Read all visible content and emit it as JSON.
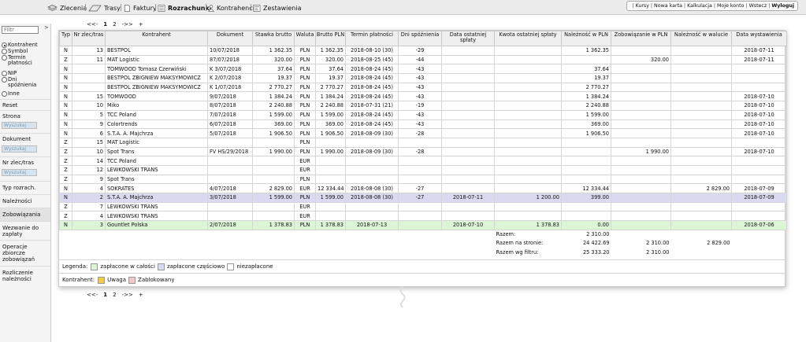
{
  "topmenu": {
    "items": [
      {
        "label": "Zlecenia"
      },
      {
        "label": "Trasy"
      },
      {
        "label": "Faktury"
      },
      {
        "label": "Rozrachunki"
      },
      {
        "label": "Kontrahenci"
      },
      {
        "label": "Zestawienia"
      }
    ],
    "active": "Rozrachunki"
  },
  "toplinks": [
    "Kursy",
    "Nowa karta",
    "Kalkulacja",
    "Moje konto",
    "Wstecz",
    "Wyloguj"
  ],
  "sidebar": {
    "filter_placeholder": "Filtr",
    "collapse": ">",
    "radio_options": [
      "Kontrahent",
      "Symbol",
      "Termin płatności",
      "NIP",
      "Dni spóźnienia",
      "Inne"
    ],
    "radio_selected": "Kontrahent",
    "reset": "Reset",
    "strona": "Strona",
    "search_placeholder": "Wyszukaj",
    "dokument": "Dokument",
    "nr_zlec": "Nr zlec/tras",
    "typ": "Typ rozrach.",
    "naleznosci": "Należności",
    "zobowiazania": "Zobowiązania",
    "wezwanie": "Wezwanie do zapłaty",
    "operacje": "Operacje zbiorcze zobowiązań",
    "rozliczenie": "Rozliczenie należności"
  },
  "pager": {
    "prev": "<<-",
    "pages": [
      "1",
      "2"
    ],
    "current": "1",
    "next": "->>",
    "add": "+"
  },
  "table": {
    "headers": [
      "Typ",
      "Nr zlec/tras",
      "Kontrahent",
      "Dokument",
      "Stawka brutto",
      "Waluta",
      "Brutto PLN",
      "Termin płatności",
      "Dni spóźnienia",
      "Data ostatniej spłaty",
      "Kwota ostatniej spłaty",
      "Należność w PLN",
      "Zobowiązanie w PLN",
      "Należność w walucie",
      "Data wystawienia"
    ],
    "rows": [
      [
        "N",
        "13",
        "BESTPOL",
        "10/07/2018",
        "1 362.35",
        "PLN",
        "1 362.35",
        "2018-08-10 (30)",
        "-29",
        "",
        "",
        "1 362.35",
        "",
        "",
        "2018-07-11"
      ],
      [
        "Z",
        "11",
        "MAT Logistic",
        "87/07/2018",
        "320.00",
        "PLN",
        "320.00",
        "2018-08-25 (45)",
        "-44",
        "",
        "",
        "",
        "320.00",
        "",
        "2018-07-11"
      ],
      [
        "N",
        "",
        "TOMWOOD Tomasz Czerwiński",
        "K 3/07/2018",
        "37.64",
        "PLN",
        "37.64",
        "2018-08-24 (45)",
        "-43",
        "",
        "",
        "37.64",
        "",
        "",
        ""
      ],
      [
        "N",
        "",
        "BESTPOL ZBIGNIEW MAKSYMOWICZ",
        "K 2/07/2018",
        "19.37",
        "PLN",
        "19.37",
        "2018-08-24 (45)",
        "-43",
        "",
        "",
        "19.37",
        "",
        "",
        ""
      ],
      [
        "N",
        "",
        "BESTPOL ZBIGNIEW MAKSYMOWICZ",
        "K 1/07/2018",
        "2 770.27",
        "PLN",
        "2 770.27",
        "2018-08-24 (45)",
        "-43",
        "",
        "",
        "2 770.27",
        "",
        "",
        ""
      ],
      [
        "N",
        "15",
        "TOMWOOD",
        "9/07/2018",
        "1 384.24",
        "PLN",
        "1 384.24",
        "2018-08-24 (45)",
        "-43",
        "",
        "",
        "1 384.24",
        "",
        "",
        "2018-07-10"
      ],
      [
        "N",
        "10",
        "Miko",
        "8/07/2018",
        "2 240.88",
        "PLN",
        "2 240.88",
        "2018-07-31 (21)",
        "-19",
        "",
        "",
        "2 240.88",
        "",
        "",
        "2018-07-10"
      ],
      [
        "N",
        "5",
        "TCC Poland",
        "7/07/2018",
        "1 599.00",
        "PLN",
        "1 599.00",
        "2018-08-24 (45)",
        "-43",
        "",
        "",
        "1 599.00",
        "",
        "",
        "2018-07-10"
      ],
      [
        "N",
        "9",
        "Colortrends",
        "6/07/2018",
        "369.00",
        "PLN",
        "369.00",
        "2018-08-24 (45)",
        "-43",
        "",
        "",
        "369.00",
        "",
        "",
        "2018-07-10"
      ],
      [
        "N",
        "6",
        "S.T.A. A. Majchrza",
        "5/07/2018",
        "1 906.50",
        "PLN",
        "1 906.50",
        "2018-08-09 (30)",
        "-28",
        "",
        "",
        "1 906.50",
        "",
        "",
        "2018-07-10"
      ],
      [
        "Z",
        "15",
        "MAT Logistic",
        "",
        "",
        "PLN",
        "",
        "",
        "",
        "",
        "",
        "",
        "",
        "",
        ""
      ],
      [
        "Z",
        "10",
        "Spot Trans",
        "FV HS/29/2018",
        "1 990.00",
        "PLN",
        "1 990.00",
        "2018-08-09 (30)",
        "-28",
        "",
        "",
        "",
        "1 990.00",
        "",
        "2018-07-10"
      ],
      [
        "Z",
        "14",
        "TCC Poland",
        "",
        "",
        "EUR",
        "",
        "",
        "",
        "",
        "",
        "",
        "",
        "",
        ""
      ],
      [
        "Z",
        "12",
        "LEWKOWSKI TRANS",
        "",
        "",
        "EUR",
        "",
        "",
        "",
        "",
        "",
        "",
        "",
        "",
        ""
      ],
      [
        "Z",
        "9",
        "Spot Trans",
        "",
        "",
        "PLN",
        "",
        "",
        "",
        "",
        "",
        "",
        "",
        "",
        ""
      ],
      [
        "N",
        "4",
        "SOKRATES",
        "4/07/2018",
        "2 829.00",
        "EUR",
        "12 334.44",
        "2018-08-08 (30)",
        "-27",
        "",
        "",
        "12 334.44",
        "",
        "2 829.00",
        "2018-07-09"
      ],
      [
        "N",
        "2",
        "S.T.A. A. Majchrza",
        "3/07/2018",
        "1 599.00",
        "PLN",
        "1 599.00",
        "2018-08-08 (30)",
        "-27",
        "2018-07-11",
        "1 200.00",
        "399.00",
        "",
        "",
        "2018-07-09"
      ],
      [
        "Z",
        "7",
        "LEWKOWSKI TRANS",
        "",
        "",
        "EUR",
        "",
        "",
        "",
        "",
        "",
        "",
        "",
        "",
        ""
      ],
      [
        "Z",
        "4",
        "LEWKOWSKI TRANS",
        "",
        "",
        "EUR",
        "",
        "",
        "",
        "",
        "",
        "",
        "",
        "",
        ""
      ],
      [
        "N",
        "3",
        "Gountlet Polska",
        "2/07/2018",
        "1 378.83",
        "PLN",
        "1 378.83",
        "2018-07-13",
        "",
        "2018-07-10",
        "1 378.83",
        "0.00",
        "",
        "",
        "2018-07-06"
      ]
    ],
    "row_status": [
      "",
      "",
      "",
      "",
      "",
      "",
      "",
      "",
      "",
      "",
      "",
      "",
      "",
      "",
      "",
      "",
      "partial",
      "",
      "",
      "paid"
    ],
    "summary": [
      {
        "label": "Razem:",
        "naleznosc": "2 310.00",
        "zobowiazanie": "",
        "waluta": ""
      },
      {
        "label": "Razem na stronie:",
        "naleznosc": "24 422.69",
        "zobowiazanie": "2 310.00",
        "waluta": "2 829.00"
      },
      {
        "label": "Razem wg filtru:",
        "naleznosc": "25 333.20",
        "zobowiazanie": "2 310.00",
        "waluta": ""
      }
    ]
  },
  "legend": {
    "title": "Legenda:",
    "items": [
      "zapłacone w całości",
      "zapłacone częściowo",
      "niezapłacone"
    ],
    "colors": [
      "#ddf5d7",
      "#d9d9ef",
      "#ffffff"
    ]
  },
  "legend2": {
    "title": "Kontrahent:",
    "items": [
      "Uwaga",
      "Zablokowany"
    ],
    "colors": [
      "#f7c948",
      "#f4c7c7"
    ]
  }
}
